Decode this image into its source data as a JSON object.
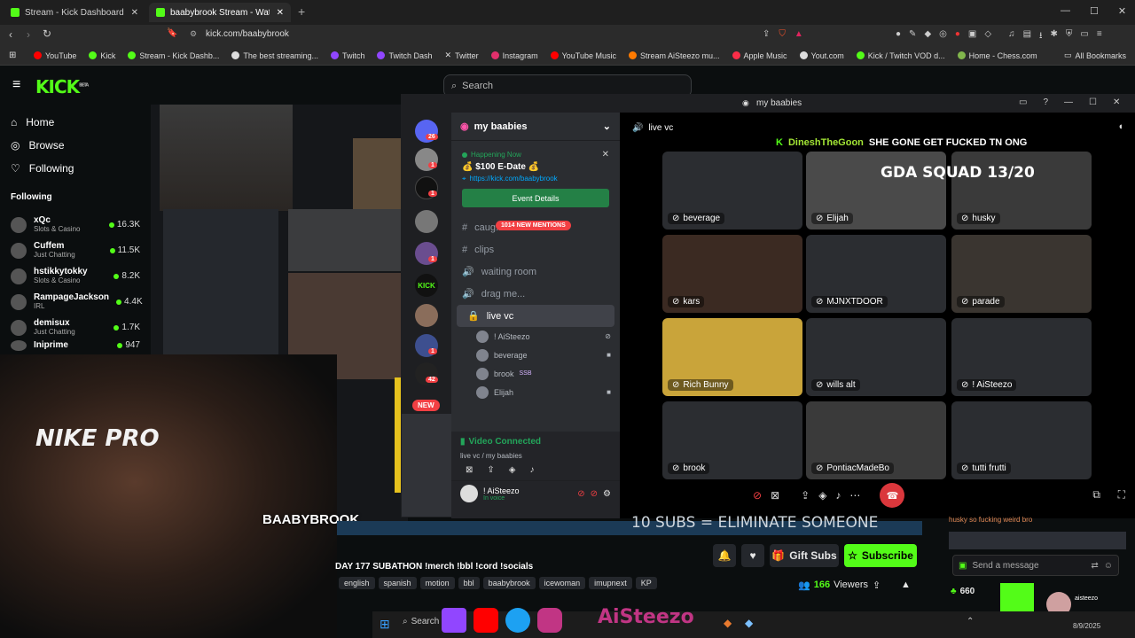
{
  "browser": {
    "tabs": [
      {
        "title": "Stream - Kick Dashboard"
      },
      {
        "title": "baabybrook Stream - Watch Live"
      }
    ],
    "url": "kick.com/baabybrook",
    "new_tab": "+",
    "bookmarks": [
      {
        "label": "YouTube",
        "color": "#ff0000"
      },
      {
        "label": "Kick",
        "color": "#53fc18"
      },
      {
        "label": "Stream - Kick Dashb...",
        "color": "#53fc18"
      },
      {
        "label": "The best streaming...",
        "color": "#dddddd"
      },
      {
        "label": "Twitch",
        "color": "#9146ff"
      },
      {
        "label": "Twitch Dash",
        "color": "#9146ff"
      },
      {
        "label": "Twitter",
        "color": "#dddddd"
      },
      {
        "label": "Instagram",
        "color": "#e1306c"
      },
      {
        "label": "YouTube Music",
        "color": "#ff0000"
      },
      {
        "label": "Stream AiSteezo mu...",
        "color": "#ff7a00"
      },
      {
        "label": "Apple Music",
        "color": "#fa2d48"
      },
      {
        "label": "Yout.com",
        "color": "#dddddd"
      },
      {
        "label": "Kick / Twitch VOD d...",
        "color": "#53fc18"
      },
      {
        "label": "Home - Chess.com",
        "color": "#81b64c"
      }
    ],
    "all_bookmarks": "All Bookmarks"
  },
  "kick": {
    "logo": "KICK",
    "beta": "BETA",
    "search_placeholder": "Search",
    "nav": [
      {
        "label": "Home",
        "icon": "home-icon"
      },
      {
        "label": "Browse",
        "icon": "compass-icon"
      },
      {
        "label": "Following",
        "icon": "heart-icon"
      }
    ],
    "following_title": "Following",
    "following": [
      {
        "name": "xQc",
        "category": "Slots & Casino",
        "viewers": "16.3K"
      },
      {
        "name": "Cuffem",
        "category": "Just Chatting",
        "viewers": "11.5K"
      },
      {
        "name": "hstikkytokky",
        "category": "Slots & Casino",
        "viewers": "8.2K"
      },
      {
        "name": "RampageJackson",
        "category": "IRL",
        "viewers": "4.4K"
      },
      {
        "name": "demisux",
        "category": "Just Chatting",
        "viewers": "1.7K"
      },
      {
        "name": "Iniprime",
        "category": "",
        "viewers": "947"
      }
    ],
    "overlay_text": "NIKE PRO",
    "streamer_tag": "BAABYBROOK",
    "sub_goal_text": "10 SUBS = ELIMINATE SOMEONE",
    "stream_title": "DAY 177 SUBATHON !merch !bbl !cord !socials",
    "tags": [
      "english",
      "spanish",
      "motion",
      "bbl",
      "baabybrook",
      "icewoman",
      "imupnext",
      "KP"
    ],
    "gift_subs": "Gift Subs",
    "subscribe": "Subscribe",
    "viewers": "166",
    "viewers_label": "Viewers",
    "chat_placeholder": "Send a message",
    "chat_points": "660",
    "chat_snippet": "husky so fucking weird bro",
    "chat_user": "aisteezo"
  },
  "discord": {
    "window_title": "my baabies",
    "server_name": "my baabies",
    "servers": [
      {
        "badge": "26"
      },
      {
        "badge": "1"
      },
      {
        "badge": "1"
      },
      {
        "badge": ""
      },
      {
        "badge": "1"
      },
      {
        "badge": ""
      },
      {
        "badge": ""
      },
      {
        "badge": "1"
      },
      {
        "badge": "42"
      }
    ],
    "new_label": "NEW",
    "event_status": "Happening Now",
    "event_title": "💰 $100 E-Date 💰",
    "event_link": "https://kick.com/baabybrook",
    "event_button": "Event Details",
    "mentions_pill": "1014 NEW MENTIONS",
    "channels": [
      {
        "name": "caug...",
        "icon": "#"
      },
      {
        "name": "clips",
        "icon": "#"
      },
      {
        "name": "waiting room",
        "icon": "🔊"
      },
      {
        "name": "drag me...",
        "icon": "🔊"
      },
      {
        "name": "live vc",
        "icon": "🔊"
      }
    ],
    "members": [
      {
        "name": "! AiSteezo",
        "badge": ""
      },
      {
        "name": "beverage",
        "badge": ""
      },
      {
        "name": "brook",
        "badge": "SSB"
      },
      {
        "name": "Elijah",
        "badge": ""
      }
    ],
    "voice_status": "Video Connected",
    "voice_sub": "live vc / my baabies",
    "user_name": "! AiSteezo",
    "user_status": "In voice",
    "vc_title": "live vc",
    "chat_line_user": "DineshTheGoon",
    "chat_line_text": "SHE GONE GET FUCKED TN ONG",
    "gda_text": "GDA SQUAD 13/20",
    "tiles": [
      {
        "name": "beverage",
        "bg": "#2b2d31"
      },
      {
        "name": "Elijah",
        "bg": "#4a4a4a"
      },
      {
        "name": "husky",
        "bg": "#3a3a3a"
      },
      {
        "name": "kars",
        "bg": "#3b2a22"
      },
      {
        "name": "MJNXTDOOR",
        "bg": "#2b2d31"
      },
      {
        "name": "parade",
        "bg": "#3a3530"
      },
      {
        "name": "Rich Bunny",
        "bg": "#c9a43a"
      },
      {
        "name": "wills alt",
        "bg": "#2b2d31"
      },
      {
        "name": "! AiSteezo",
        "bg": "#2b2d31"
      },
      {
        "name": "brook",
        "bg": "#2b2d31"
      },
      {
        "name": "PontiacMadeBo",
        "bg": "#3a3a3a"
      },
      {
        "name": "tutti frutti",
        "bg": "#2b2d31"
      }
    ]
  },
  "taskbar": {
    "search": "Search",
    "date": "8/9/2025"
  },
  "colors": {
    "kick_green": "#53fc18",
    "discord_blurple": "#5865f2",
    "discord_green": "#23a55a",
    "end_call": "#da373c"
  }
}
